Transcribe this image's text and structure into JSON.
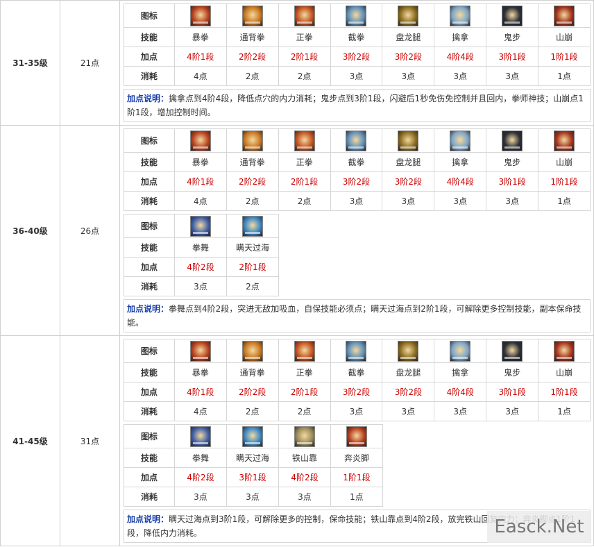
{
  "labels": {
    "icon": "图标",
    "skill": "技能",
    "points": "加点",
    "cost": "消耗",
    "note_label": "加点说明："
  },
  "icon_colors": {
    "baoquan": "#b8401c",
    "tongbei": "#c9761e",
    "zhengquan": "#c2521e",
    "jiequan": "#5f8fb8",
    "panlong": "#8a6a1e",
    "qinna": "#7fa6c8",
    "guibu": "#2b2e36",
    "shanbeng": "#a3321a",
    "quanwu": "#3e5ea8",
    "mantian": "#3b86c4",
    "tieshan": "#9a8a58",
    "benyan": "#b53a1a"
  },
  "sections": [
    {
      "level": "31-35级",
      "points": "21点",
      "tables": [
        {
          "skills": [
            {
              "icon": "baoquan",
              "name": "暴拳",
              "add": "4阶1段",
              "cost": "4点"
            },
            {
              "icon": "tongbei",
              "name": "通背拳",
              "add": "2阶2段",
              "cost": "2点"
            },
            {
              "icon": "zhengquan",
              "name": "正拳",
              "add": "2阶1段",
              "cost": "2点"
            },
            {
              "icon": "jiequan",
              "name": "截拳",
              "add": "3阶2段",
              "cost": "3点"
            },
            {
              "icon": "panlong",
              "name": "盘龙腿",
              "add": "3阶2段",
              "cost": "3点"
            },
            {
              "icon": "qinna",
              "name": "擒拿",
              "add": "4阶4段",
              "cost": "3点"
            },
            {
              "icon": "guibu",
              "name": "鬼步",
              "add": "3阶1段",
              "cost": "3点"
            },
            {
              "icon": "shanbeng",
              "name": "山崩",
              "add": "1阶1段",
              "cost": "1点"
            }
          ]
        }
      ],
      "note": "擒拿点到4阶4段，降低点穴的内力消耗；鬼步点到3阶1段，闪避后1秒免伤免控制并且回内，拳师神技；山崩点1阶1段，增加控制时间。"
    },
    {
      "level": "36-40级",
      "points": "26点",
      "tables": [
        {
          "skills": [
            {
              "icon": "baoquan",
              "name": "暴拳",
              "add": "4阶1段",
              "cost": "4点"
            },
            {
              "icon": "tongbei",
              "name": "通背拳",
              "add": "2阶2段",
              "cost": "2点"
            },
            {
              "icon": "zhengquan",
              "name": "正拳",
              "add": "2阶1段",
              "cost": "2点"
            },
            {
              "icon": "jiequan",
              "name": "截拳",
              "add": "3阶2段",
              "cost": "3点"
            },
            {
              "icon": "panlong",
              "name": "盘龙腿",
              "add": "3阶2段",
              "cost": "3点"
            },
            {
              "icon": "qinna",
              "name": "擒拿",
              "add": "4阶4段",
              "cost": "3点"
            },
            {
              "icon": "guibu",
              "name": "鬼步",
              "add": "3阶1段",
              "cost": "3点"
            },
            {
              "icon": "shanbeng",
              "name": "山崩",
              "add": "1阶1段",
              "cost": "1点"
            }
          ]
        },
        {
          "skills": [
            {
              "icon": "quanwu",
              "name": "拳舞",
              "add": "4阶2段",
              "cost": "3点"
            },
            {
              "icon": "mantian",
              "name": "瞒天过海",
              "add": "2阶1段",
              "cost": "2点"
            }
          ]
        }
      ],
      "note": "拳舞点到4阶2段，突进无敌加吸血，自保技能必须点；瞒天过海点到2阶1段，可解除更多控制技能，副本保命技能。"
    },
    {
      "level": "41-45级",
      "points": "31点",
      "tables": [
        {
          "skills": [
            {
              "icon": "baoquan",
              "name": "暴拳",
              "add": "4阶1段",
              "cost": "4点"
            },
            {
              "icon": "tongbei",
              "name": "通背拳",
              "add": "2阶2段",
              "cost": "2点"
            },
            {
              "icon": "zhengquan",
              "name": "正拳",
              "add": "2阶1段",
              "cost": "2点"
            },
            {
              "icon": "jiequan",
              "name": "截拳",
              "add": "3阶2段",
              "cost": "3点"
            },
            {
              "icon": "panlong",
              "name": "盘龙腿",
              "add": "3阶2段",
              "cost": "3点"
            },
            {
              "icon": "qinna",
              "name": "擒拿",
              "add": "4阶4段",
              "cost": "3点"
            },
            {
              "icon": "guibu",
              "name": "鬼步",
              "add": "3阶1段",
              "cost": "3点"
            },
            {
              "icon": "shanbeng",
              "name": "山崩",
              "add": "1阶1段",
              "cost": "1点"
            }
          ]
        },
        {
          "skills": [
            {
              "icon": "quanwu",
              "name": "拳舞",
              "add": "4阶2段",
              "cost": "3点"
            },
            {
              "icon": "mantian",
              "name": "瞒天过海",
              "add": "3阶1段",
              "cost": "3点"
            },
            {
              "icon": "tieshan",
              "name": "铁山靠",
              "add": "4阶2段",
              "cost": "3点"
            },
            {
              "icon": "benyan",
              "name": "奔炎脚",
              "add": "1阶1段",
              "cost": "1点"
            }
          ]
        }
      ],
      "note": "瞒天过海点到3阶1段，可解除更多的控制，保命技能；铁山靠点到4阶2段，放完铁山回复内力；奔炎脚点1阶1段，降低内力消耗。"
    }
  ],
  "watermark": "Easck.Net"
}
